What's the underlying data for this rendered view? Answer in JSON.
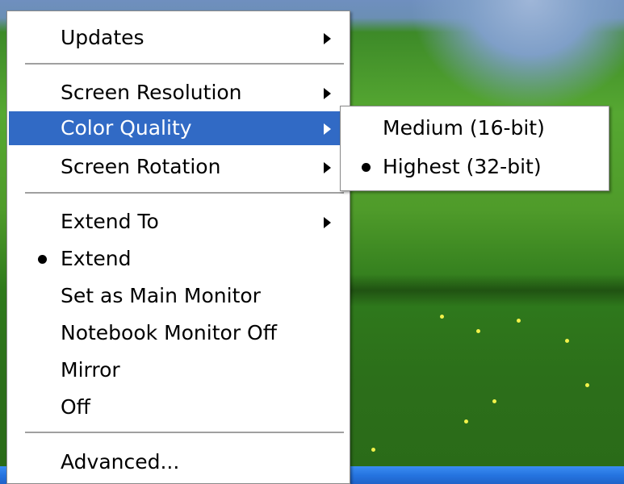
{
  "menu": {
    "items": [
      {
        "label": "Updates",
        "submenu": true
      },
      {
        "label": "Screen Resolution",
        "submenu": true
      },
      {
        "label": "Color Quality",
        "submenu": true,
        "selected": true
      },
      {
        "label": "Screen Rotation",
        "submenu": true
      },
      {
        "label": "Extend To",
        "submenu": true
      },
      {
        "label": "Extend",
        "checked": true
      },
      {
        "label": "Set as Main Monitor"
      },
      {
        "label": "Notebook Monitor Off"
      },
      {
        "label": "Mirror"
      },
      {
        "label": "Off"
      },
      {
        "label": "Advanced..."
      }
    ]
  },
  "submenu": {
    "items": [
      {
        "label": "Medium (16-bit)"
      },
      {
        "label": "Highest (32-bit)",
        "checked": true
      }
    ]
  },
  "colors": {
    "highlight": "#316ac5",
    "menu_bg": "#ffffff",
    "taskbar": "#2574e0"
  }
}
